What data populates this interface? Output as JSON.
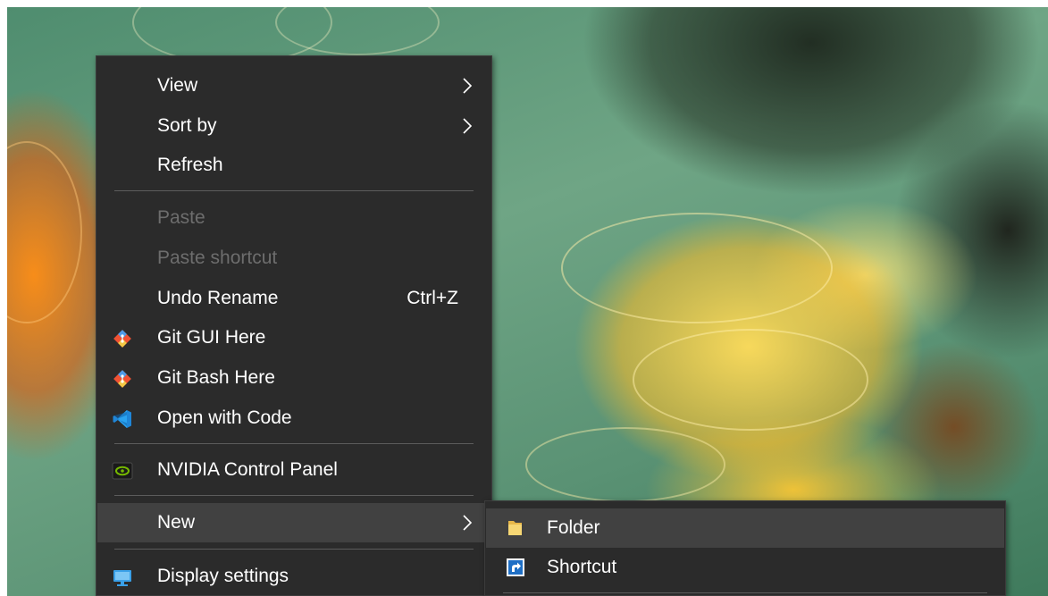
{
  "context_menu": {
    "items": [
      {
        "label": "View",
        "has_submenu": true
      },
      {
        "label": "Sort by",
        "has_submenu": true
      },
      {
        "label": "Refresh"
      },
      {
        "label": "Paste",
        "disabled": true
      },
      {
        "label": "Paste shortcut",
        "disabled": true
      },
      {
        "label": "Undo Rename",
        "shortcut": "Ctrl+Z"
      },
      {
        "label": "Git GUI Here",
        "icon": "git-icon"
      },
      {
        "label": "Git Bash Here",
        "icon": "git-icon"
      },
      {
        "label": "Open with Code",
        "icon": "vscode-icon"
      },
      {
        "label": "NVIDIA Control Panel",
        "icon": "nvidia-icon"
      },
      {
        "label": "New",
        "has_submenu": true,
        "highlighted": true
      },
      {
        "label": "Display settings",
        "icon": "display-icon"
      }
    ]
  },
  "new_submenu": {
    "items": [
      {
        "label": "Folder",
        "icon": "folder-icon",
        "highlighted": true
      },
      {
        "label": "Shortcut",
        "icon": "shortcut-icon"
      }
    ]
  },
  "colors": {
    "menu_background": "#2b2b2b",
    "highlight": "#414141",
    "text": "#ffffff",
    "disabled_text": "#6d6d6d",
    "separator": "#5c5c5c"
  }
}
